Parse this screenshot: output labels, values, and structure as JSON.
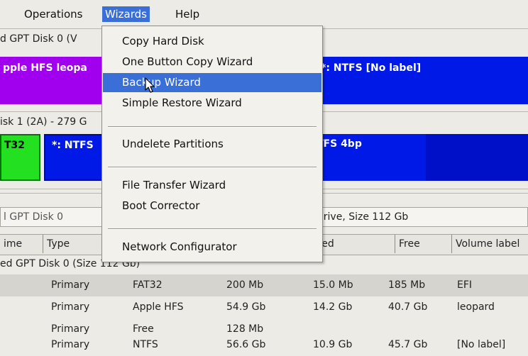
{
  "menubar": {
    "items": [
      {
        "label": "Operations",
        "accel": "O"
      },
      {
        "label": "Wizards",
        "accel": "i"
      },
      {
        "label": "Help",
        "accel": "H"
      }
    ]
  },
  "wizards_menu": {
    "items": [
      "Copy Hard Disk",
      "One Button Copy Wizard",
      "Backup Wizard",
      "Simple Restore Wizard",
      "Undelete Partitions",
      "File Transfer Wizard",
      "Boot Corrector",
      "Network Configurator"
    ],
    "selected": "Backup Wizard"
  },
  "disk0": {
    "title": "d GPT Disk 0 (V",
    "partitions": [
      {
        "label": "pple HFS leopa",
        "color": "#a100ee"
      },
      {
        "label": "*: NTFS [No label]",
        "color": "#0019e6"
      }
    ]
  },
  "disk1": {
    "title": "isk 1 (2A) - 279 G",
    "partitions": [
      {
        "label": "T32",
        "color": "#23e021"
      },
      {
        "label": "*: NTFS",
        "color": "#0019e6"
      },
      {
        "label": "TFS 4bp",
        "color": "#0019e6"
      }
    ]
  },
  "infobar": {
    "disk_field": "l GPT Disk 0",
    "drive_field": "Drive, Size 112 Gb"
  },
  "table": {
    "headers": [
      "ime",
      "Type",
      "sed",
      "Free",
      "Volume label"
    ],
    "group_label": "ed GPT Disk 0 (Size 112 Gb)",
    "rows": [
      {
        "type": "Primary",
        "fs": "FAT32",
        "size": "200 Mb",
        "used": "15.0 Mb",
        "free": "185 Mb",
        "label": "EFI"
      },
      {
        "type": "Primary",
        "fs": "Apple HFS",
        "size": "54.9 Gb",
        "used": "14.2 Gb",
        "free": "40.7 Gb",
        "label": "leopard"
      },
      {
        "type": "Primary",
        "fs": "Free",
        "size": "128 Mb",
        "used": "",
        "free": "",
        "label": ""
      },
      {
        "type": "Primary",
        "fs": "NTFS",
        "size": "56.6 Gb",
        "used": "10.9 Gb",
        "free": "45.7 Gb",
        "label": "[No label]"
      }
    ]
  },
  "colors": {
    "menu_highlight": "#3a6fd8",
    "ntfs_blue": "#0019e6",
    "hfs_purple": "#a100ee",
    "fat32_green": "#23e021",
    "selected_row": "#d6d4ce"
  },
  "cursor": "arrow-cursor-icon"
}
